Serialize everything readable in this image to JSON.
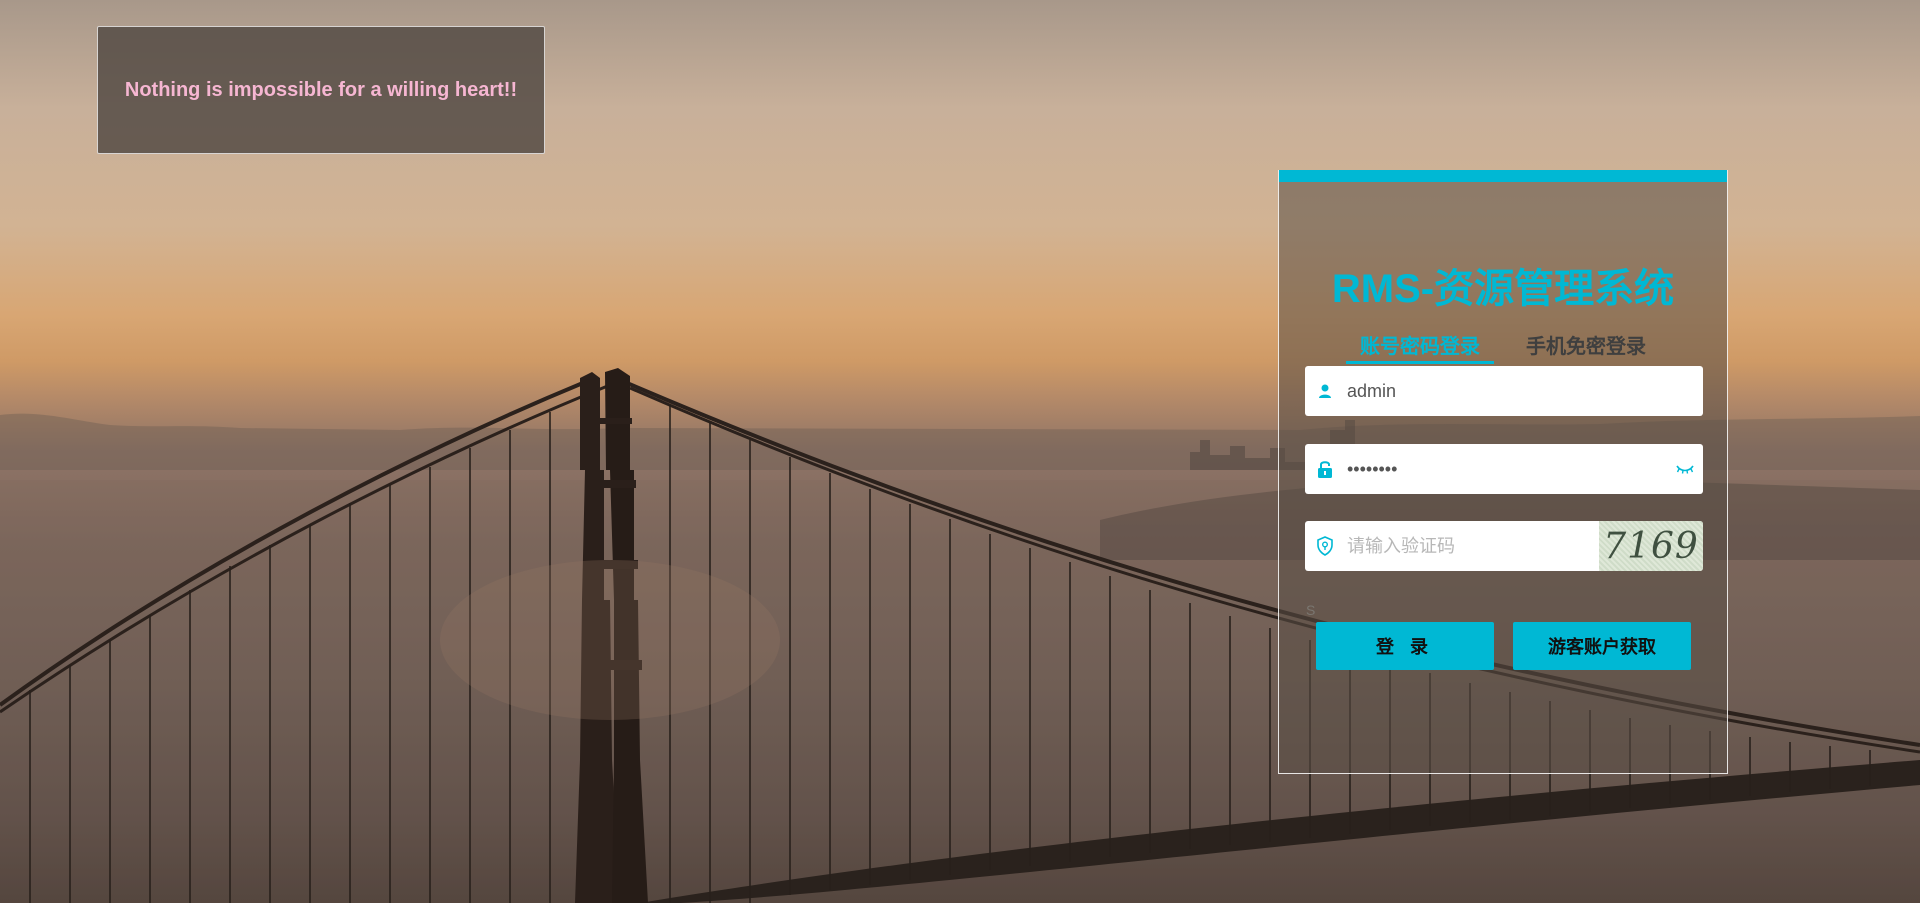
{
  "background": {
    "scene": "golden-gate-bridge-sunset"
  },
  "quote": {
    "text": "Nothing is impossible for a willing heart!!",
    "color": "#f6b6d2"
  },
  "login": {
    "title": "RMS-资源管理系统",
    "accent_color": "#00b8d4",
    "tabs": [
      {
        "label": "账号密码登录",
        "active": true
      },
      {
        "label": "手机免密登录",
        "active": false
      }
    ],
    "username": {
      "icon": "user-icon",
      "value": "admin",
      "placeholder": ""
    },
    "password": {
      "icon": "lock-icon",
      "value": "12345678",
      "toggle_icon": "eye-closed-icon"
    },
    "captcha": {
      "icon": "shield-icon",
      "placeholder": "请输入验证码",
      "image_text": "7169"
    },
    "small_note": "S",
    "buttons": {
      "login_label": "登录",
      "guest_label": "游客账户获取"
    }
  }
}
